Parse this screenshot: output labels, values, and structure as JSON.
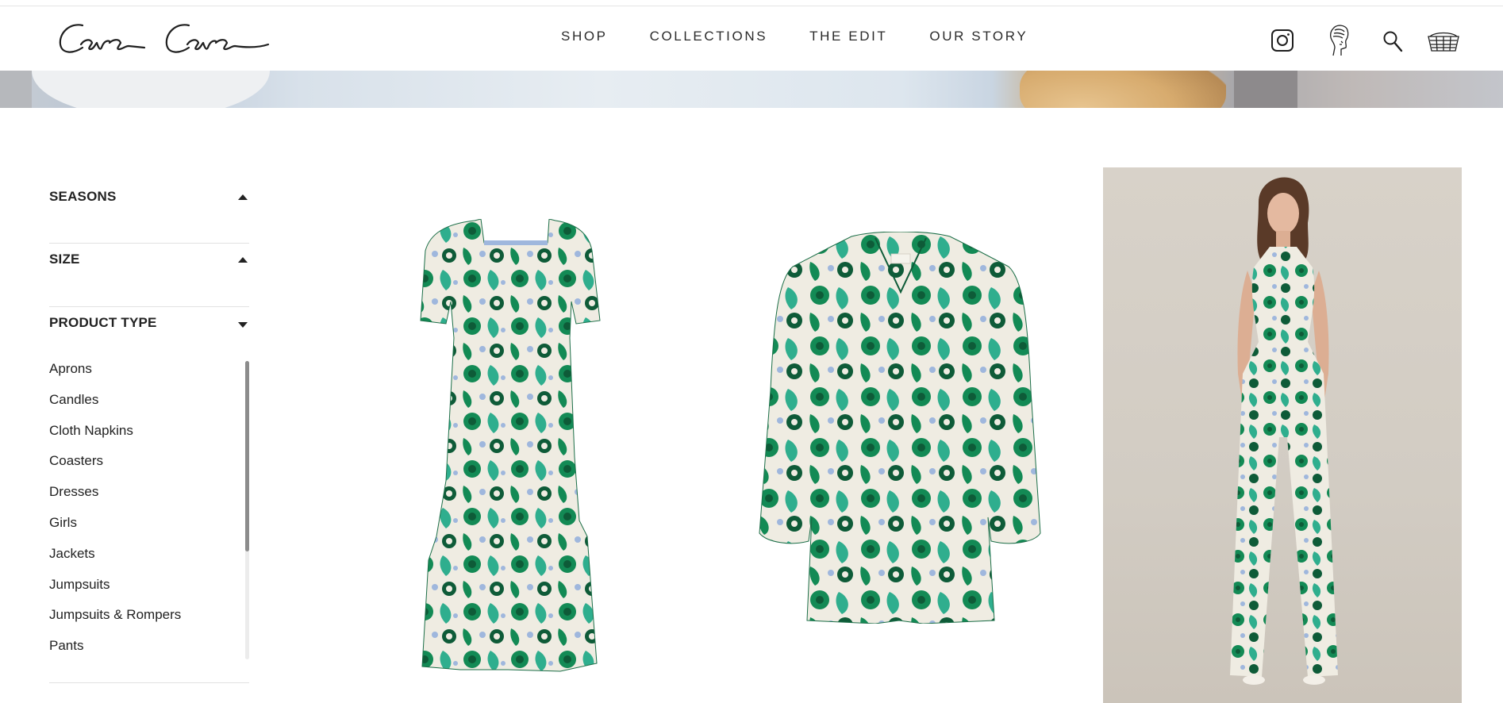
{
  "brand": {
    "logo_text": "Cara Cara"
  },
  "nav": {
    "items": [
      {
        "label": "SHOP"
      },
      {
        "label": "COLLECTIONS"
      },
      {
        "label": "THE EDIT"
      },
      {
        "label": "OUR STORY"
      }
    ]
  },
  "header_icons": [
    "instagram-icon",
    "account-bust-icon",
    "search-icon",
    "cart-basket-icon"
  ],
  "filters": {
    "seasons": {
      "label": "SEASONS",
      "state": "collapsed"
    },
    "size": {
      "label": "SIZE",
      "state": "collapsed"
    },
    "product_type": {
      "label": "PRODUCT TYPE",
      "state": "expanded",
      "options": [
        {
          "label": "Aprons"
        },
        {
          "label": "Candles"
        },
        {
          "label": "Cloth Napkins"
        },
        {
          "label": "Coasters"
        },
        {
          "label": "Dresses"
        },
        {
          "label": "Girls"
        },
        {
          "label": "Jackets"
        },
        {
          "label": "Jumpsuits"
        },
        {
          "label": "Jumpsuits & Rompers"
        },
        {
          "label": "Pants"
        }
      ]
    }
  },
  "colors": {
    "print_green": "#138a55",
    "print_dark": "#0e5b38",
    "print_teal": "#2fae8e",
    "print_blue": "#9fb7dd",
    "print_cream": "#efece2",
    "photo_bg": "#d4cec5"
  }
}
